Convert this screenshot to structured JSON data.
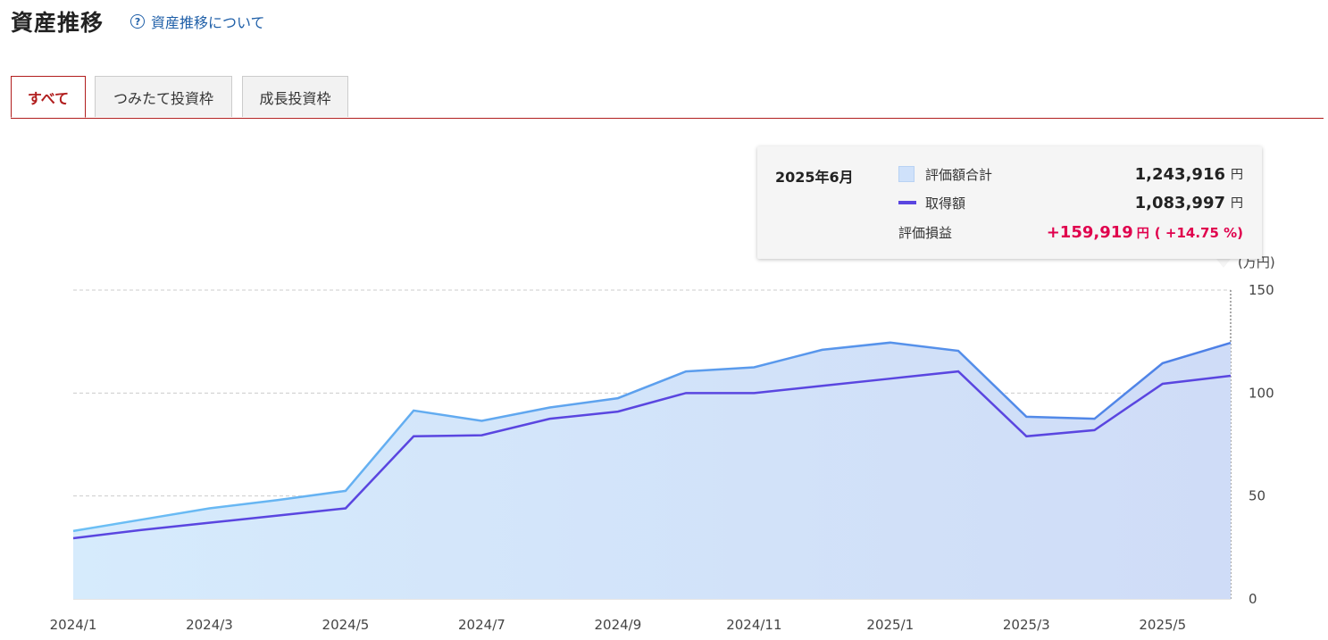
{
  "header": {
    "title": "資産推移",
    "help_link": "資産推移について"
  },
  "tabs": [
    {
      "label": "すべて",
      "active": true
    },
    {
      "label": "つみたて投資枠",
      "active": false
    },
    {
      "label": "成長投資枠",
      "active": false
    }
  ],
  "tooltip": {
    "date": "2025年6月",
    "valuation_label": "評価額合計",
    "valuation_value": "1,243,916",
    "cost_label": "取得額",
    "cost_value": "1,083,997",
    "unit": "円",
    "gain_label": "評価損益",
    "gain_value": "+159,919",
    "gain_pct": "( +14.75 %)"
  },
  "colors": {
    "accent": "#b11d1d",
    "valuation_line": "#5b9ef0",
    "cost_line": "#5a46e0",
    "gain": "#e0004d"
  },
  "chart_data": {
    "type": "area",
    "y_unit_label": "(万円)",
    "ylim": [
      0,
      150
    ],
    "yticks": [
      0,
      50,
      100,
      150
    ],
    "x": [
      "2024/1",
      "2024/2",
      "2024/3",
      "2024/4",
      "2024/5",
      "2024/6",
      "2024/7",
      "2024/8",
      "2024/9",
      "2024/10",
      "2024/11",
      "2024/12",
      "2025/1",
      "2025/2",
      "2025/3",
      "2025/4",
      "2025/5",
      "2025/6"
    ],
    "xticks": [
      "2024/1",
      "2024/3",
      "2024/5",
      "2024/7",
      "2024/9",
      "2024/11",
      "2025/1",
      "2025/3",
      "2025/5"
    ],
    "grid": true,
    "series": [
      {
        "name": "評価額合計",
        "style": "area",
        "values": [
          33,
          38.5,
          44,
          48,
          52.5,
          91.5,
          86.5,
          93,
          97.5,
          110.5,
          112.5,
          121,
          124.5,
          120.5,
          88.5,
          87.5,
          114.5,
          124.4
        ]
      },
      {
        "name": "取得額",
        "style": "line",
        "values": [
          29.5,
          33.5,
          37,
          40.5,
          44,
          79,
          79.5,
          87.5,
          91,
          100,
          100,
          103.5,
          107,
          110.5,
          79,
          82,
          104.5,
          108.4
        ]
      }
    ]
  }
}
